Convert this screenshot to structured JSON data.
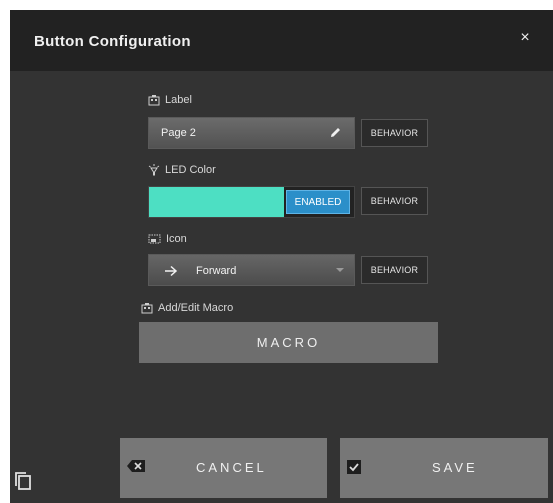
{
  "dialog": {
    "title": "Button Configuration",
    "close_glyph": "×"
  },
  "label_section": {
    "heading": "Label",
    "value": "Page 2",
    "behavior_label": "BEHAVIOR"
  },
  "led_section": {
    "heading": "LED Color",
    "color": "#4ddfc3",
    "toggle_label": "ENABLED",
    "behavior_label": "BEHAVIOR"
  },
  "icon_section": {
    "heading": "Icon",
    "glyph": "→",
    "selected": "Forward",
    "behavior_label": "BEHAVIOR"
  },
  "macro_section": {
    "heading": "Add/Edit Macro",
    "button_label": "MACRO"
  },
  "footer": {
    "cancel_label": "CANCEL",
    "save_label": "SAVE"
  },
  "colors": {
    "accent": "#2b8fc9",
    "led": "#4ddfc3"
  }
}
